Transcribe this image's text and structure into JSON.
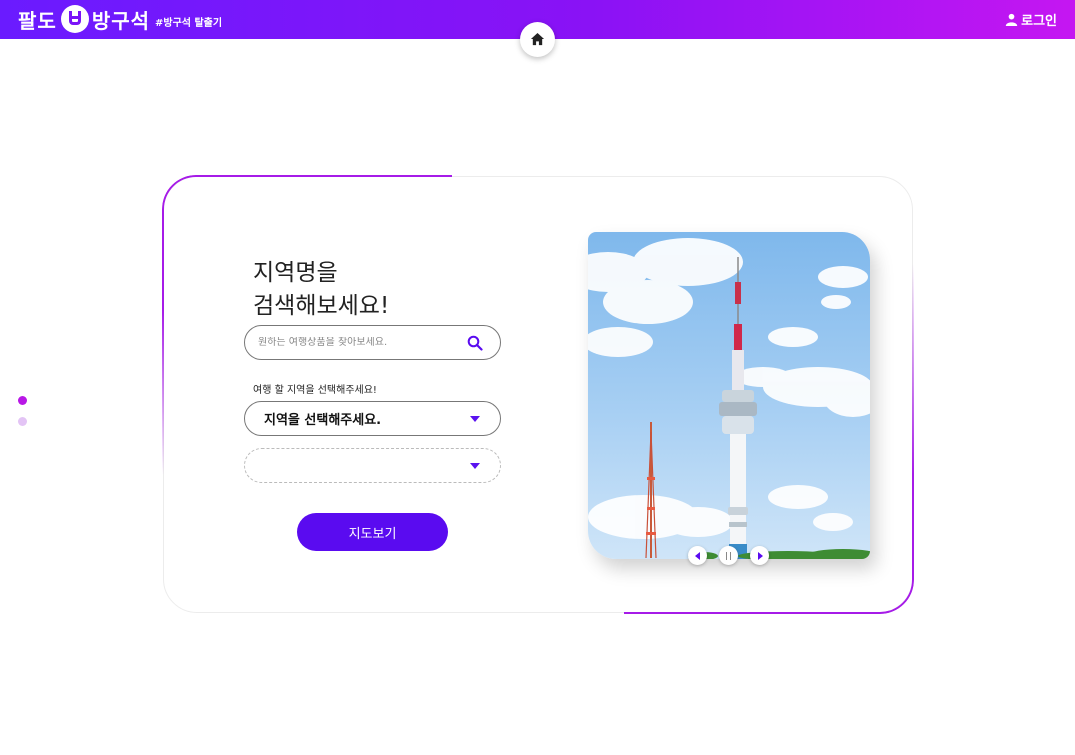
{
  "header": {
    "logo_part1": "팔도",
    "logo_part2": "방구석",
    "logo_tag": "#방구석 탈출기",
    "login_label": "로그인",
    "accent": "#7a14f8"
  },
  "search_panel": {
    "heading_line1": "지역명을",
    "heading_line2": "검색해보세요!",
    "search_placeholder": "원하는 여행상품을 찾아보세요.",
    "region_label": "여행 할 지역을 선택해주세요!",
    "region_select_value": "지역을 선택해주세요.",
    "subregion_select_value": "",
    "map_button_label": "지도보기"
  },
  "slider": {
    "image_subject": "N Seoul Tower",
    "controls": [
      "prev-icon",
      "pause-icon",
      "next-icon"
    ],
    "active_page": 1,
    "page_count": 2
  }
}
